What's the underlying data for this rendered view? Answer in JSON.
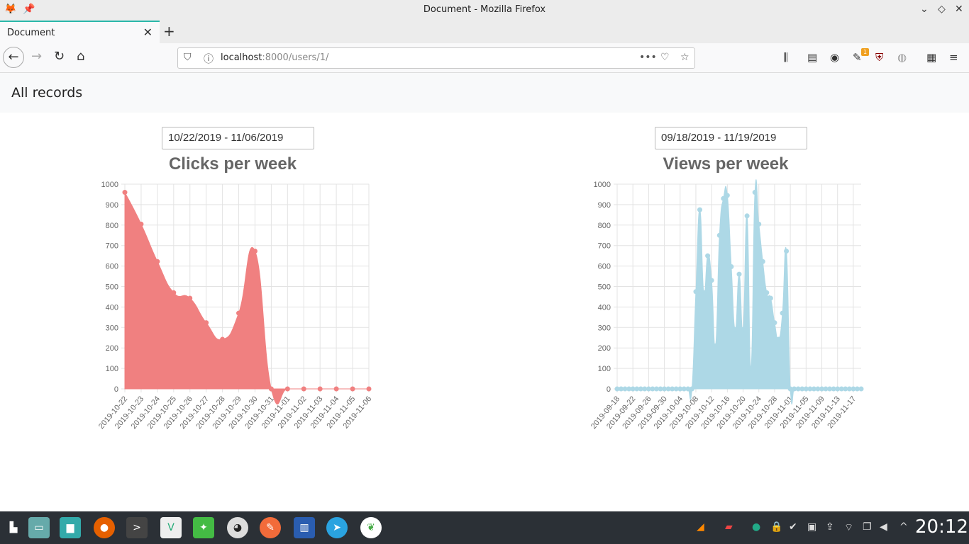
{
  "window": {
    "title": "Document - Mozilla Firefox"
  },
  "tab": {
    "label": "Document",
    "close": "✕",
    "new": "+"
  },
  "nav": {
    "url_host": "localhost",
    "url_rest": ":8000/users/1/",
    "dots": "•••"
  },
  "extension_badge": "1",
  "page": {
    "heading": "All records"
  },
  "clicks": {
    "date_range": "10/22/2019 - 11/06/2019",
    "title": "Clicks per week"
  },
  "views": {
    "date_range": "09/18/2019 - 11/19/2019",
    "title": "Views per week"
  },
  "chart_data": [
    {
      "type": "area",
      "title": "Clicks per week",
      "color": "#f08080",
      "ylim": [
        0,
        1000
      ],
      "yticks": [
        0,
        100,
        200,
        300,
        400,
        500,
        600,
        700,
        800,
        900,
        1000
      ],
      "x": [
        "2019-10-22",
        "2019-10-23",
        "2019-10-24",
        "2019-10-25",
        "2019-10-26",
        "2019-10-27",
        "2019-10-28",
        "2019-10-29",
        "2019-10-30",
        "2019-10-31",
        "2019-11-01",
        "2019-11-02",
        "2019-11-03",
        "2019-11-04",
        "2019-11-05",
        "2019-11-06"
      ],
      "values": [
        960,
        805,
        622,
        470,
        443,
        323,
        242,
        370,
        673,
        0,
        0,
        0,
        0,
        0,
        0,
        0
      ],
      "grid": true
    },
    {
      "type": "area",
      "title": "Views per week",
      "color": "#add8e6",
      "ylim": [
        0,
        1000
      ],
      "yticks": [
        0,
        100,
        200,
        300,
        400,
        500,
        600,
        700,
        800,
        900,
        1000
      ],
      "xtick_labels": [
        "2019-09-18",
        "2019-09-22",
        "2019-09-26",
        "2019-09-30",
        "2019-10-04",
        "2019-10-08",
        "2019-10-12",
        "2019-10-16",
        "2019-10-20",
        "2019-10-24",
        "2019-10-28",
        "2019-11-01",
        "2019-11-05",
        "2019-11-09",
        "2019-11-13",
        "2019-11-17"
      ],
      "x_start": "2019-09-18",
      "x_end": "2019-11-19",
      "values": [
        0,
        0,
        0,
        0,
        0,
        0,
        0,
        0,
        0,
        0,
        0,
        0,
        0,
        0,
        0,
        0,
        0,
        0,
        0,
        0,
        475,
        875,
        470,
        650,
        530,
        210,
        750,
        930,
        945,
        597,
        290,
        560,
        290,
        845,
        100,
        960,
        805,
        622,
        470,
        443,
        323,
        242,
        370,
        673,
        0,
        0,
        0,
        0,
        0,
        0,
        0,
        0,
        0,
        0,
        0,
        0,
        0,
        0,
        0,
        0,
        0,
        0,
        0
      ],
      "grid": true
    }
  ],
  "taskbar": {
    "clock": "20:12"
  },
  "colors": {
    "accent_tab": "#2ab7a9",
    "taskbar": "#2b3036"
  }
}
